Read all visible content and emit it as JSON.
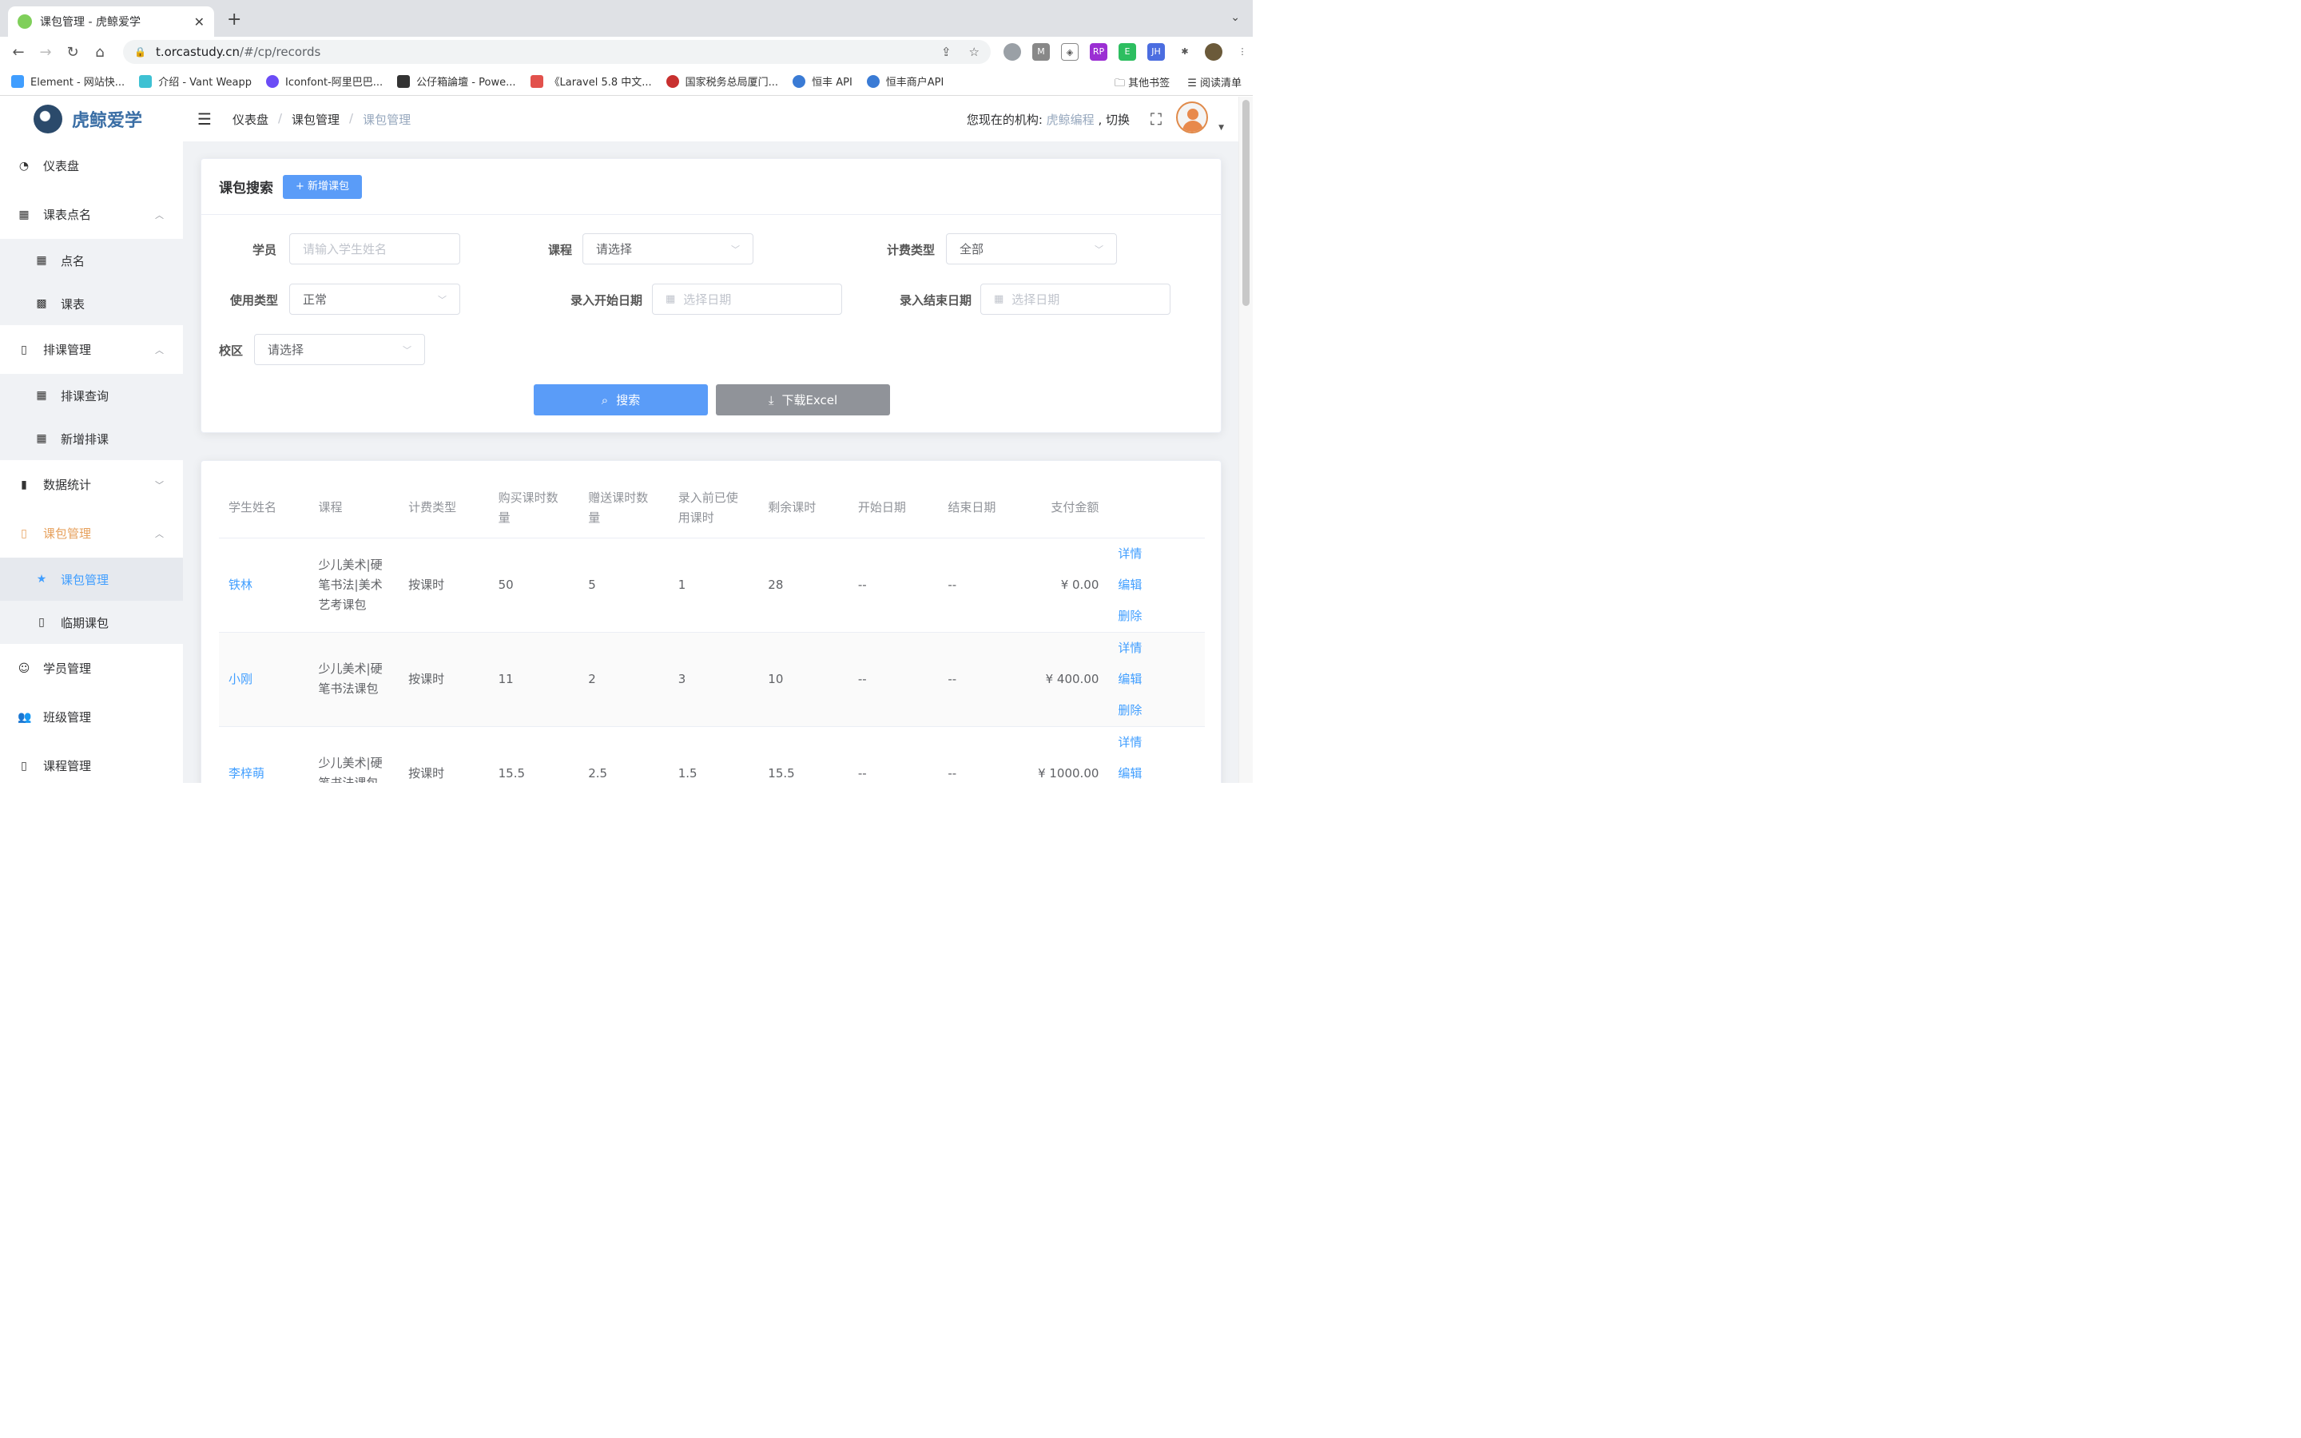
{
  "browser": {
    "tab_title": "课包管理 - 虎鲸爱学",
    "url_host": "t.orcastudy.cn",
    "url_path": "/#/cp/records",
    "bookmarks": [
      "Element - 网站快...",
      "介绍 - Vant Weapp",
      "Iconfont-阿里巴巴...",
      "公仔箱論壇 - Powe...",
      "《Laravel 5.8 中文...",
      "国家税务总局厦门...",
      "恒丰 API",
      "恒丰商户API"
    ],
    "bookmark_folder": "其他书签",
    "reading_list": "阅读清单"
  },
  "app": {
    "logo": "虎鲸爱学",
    "breadcrumb": [
      "仪表盘",
      "课包管理",
      "课包管理"
    ],
    "org_prefix": "您现在的机构:",
    "org_name": "虎鲸编程",
    "org_switch": ", 切换"
  },
  "sidebar": {
    "dashboard": "仪表盘",
    "schedule": "课表点名",
    "schedule_sub": [
      "点名",
      "课表"
    ],
    "arrange": "排课管理",
    "arrange_sub": [
      "排课查询",
      "新增排课"
    ],
    "stats": "数据统计",
    "package": "课包管理",
    "package_sub": [
      "课包管理",
      "临期课包"
    ],
    "students": "学员管理",
    "classes": "班级管理",
    "courses": "课程管理"
  },
  "search": {
    "title": "课包搜索",
    "add_button": "+ 新增课包",
    "labels": {
      "student": "学员",
      "course": "课程",
      "billing": "计费类型",
      "usage": "使用类型",
      "start": "录入开始日期",
      "end": "录入结束日期",
      "campus": "校区"
    },
    "student_placeholder": "请输入学生姓名",
    "course_value": "请选择",
    "billing_value": "全部",
    "usage_value": "正常",
    "date_placeholder": "选择日期",
    "campus_value": "请选择",
    "search_button": "搜索",
    "excel_button": "下载Excel"
  },
  "table": {
    "columns": [
      "学生姓名",
      "课程",
      "计费类型",
      "购买课时数量",
      "赠送课时数量",
      "录入前已使用课时",
      "剩余课时",
      "开始日期",
      "结束日期",
      "支付金额"
    ],
    "rows": [
      {
        "name": "铁林",
        "course": "少儿美术|硬笔书法|美术艺考课包",
        "billing": "按课时",
        "bought": "50",
        "gift": "5",
        "used": "1",
        "remain": "28",
        "start": "--",
        "end": "--",
        "amount": "¥ 0.00"
      },
      {
        "name": "小刚",
        "course": "少儿美术|硬笔书法课包",
        "billing": "按课时",
        "bought": "11",
        "gift": "2",
        "used": "3",
        "remain": "10",
        "start": "--",
        "end": "--",
        "amount": "¥ 400.00"
      },
      {
        "name": "李梓萌",
        "course": "少儿美术|硬笔书法课包",
        "billing": "按课时",
        "bought": "15.5",
        "gift": "2.5",
        "used": "1.5",
        "remain": "15.5",
        "start": "--",
        "end": "--",
        "amount": "¥ 1000.00"
      }
    ],
    "ops": {
      "detail": "详情",
      "edit": "编辑",
      "delete": "删除"
    }
  },
  "colors": {
    "primary": "#409eff",
    "accent_orange": "#e6a05c",
    "excel_gray": "#909399"
  }
}
